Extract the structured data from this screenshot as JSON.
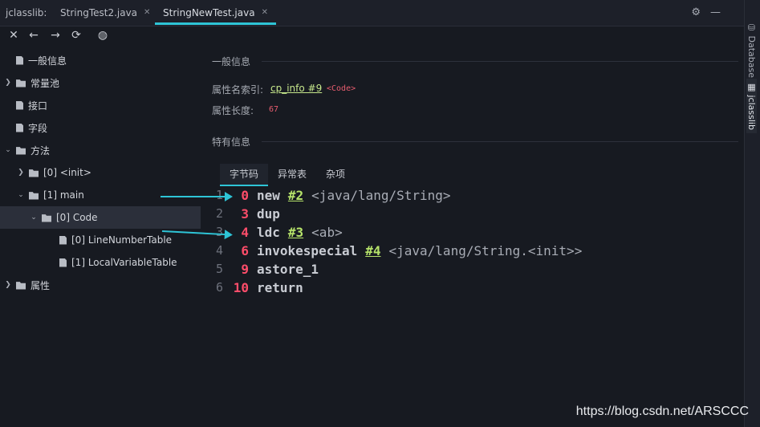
{
  "app": {
    "title": "jclasslib:"
  },
  "tabs": [
    {
      "label": "StringTest2.java",
      "active": false
    },
    {
      "label": "StringNewTest.java",
      "active": true
    }
  ],
  "toolbar_icons": [
    "close-icon",
    "back-arrow-icon",
    "forward-arrow-icon",
    "refresh-icon",
    "web-icon"
  ],
  "tree": {
    "general_info": "一般信息",
    "constant_pool": "常量池",
    "interfaces": "接口",
    "fields": "字段",
    "methods": "方法",
    "method_init": "[0] <init>",
    "method_main": "[1] main",
    "code": "[0] Code",
    "line_number_table": "[0] LineNumberTable",
    "local_variable_table": "[1] LocalVariableTable",
    "attributes": "属性"
  },
  "detail": {
    "general_section": "一般信息",
    "attr_name_label": "属性名索引:",
    "attr_name_link": "cp_info #9",
    "attr_name_tag": "<Code>",
    "attr_length_label": "属性长度:",
    "attr_length_value": "67",
    "specific_section": "特有信息",
    "subtabs": [
      "字节码",
      "异常表",
      "杂项"
    ]
  },
  "bytecode": [
    {
      "line": "1",
      "offset": "0",
      "op": "new",
      "ref": "#2",
      "comment": "<java/lang/String>"
    },
    {
      "line": "2",
      "offset": "3",
      "op": "dup",
      "ref": "",
      "comment": ""
    },
    {
      "line": "3",
      "offset": "4",
      "op": "ldc",
      "ref": "#3",
      "comment": "<ab>"
    },
    {
      "line": "4",
      "offset": "6",
      "op": "invokespecial",
      "ref": "#4",
      "comment": "<java/lang/String.<init>>"
    },
    {
      "line": "5",
      "offset": "9",
      "op": "astore_1",
      "ref": "",
      "comment": ""
    },
    {
      "line": "6",
      "offset": "10",
      "op": "return",
      "ref": "",
      "comment": ""
    }
  ],
  "side_panel": {
    "database": "Database",
    "jclasslib": "jclasslib"
  },
  "watermark": "https://blog.csdn.net/ARSCCC",
  "colors": {
    "accent": "#2ec4d6",
    "offset": "#ff4d6a",
    "ref": "#b6e36a",
    "background": "#171a21"
  }
}
